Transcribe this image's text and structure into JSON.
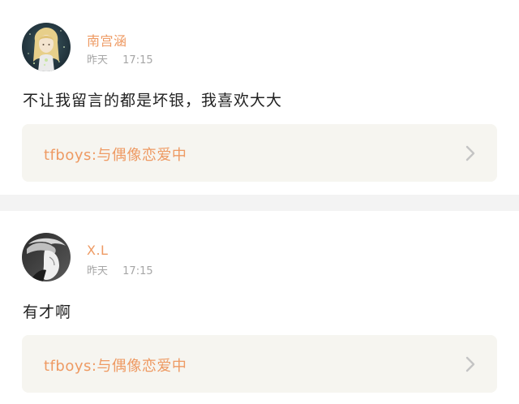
{
  "comments": [
    {
      "username": "南宫涵",
      "date": "昨天",
      "time": "17:15",
      "text": "不让我留言的都是坏银，我喜欢大大",
      "topic": "tfboys:与偶像恋爱中",
      "avatar_icon": "illustrated-girl-avatar"
    },
    {
      "username": "X.L",
      "date": "昨天",
      "time": "17:15",
      "text": "有才啊",
      "topic": "tfboys:与偶像恋爱中",
      "avatar_icon": "monochrome-portrait-avatar"
    }
  ],
  "colors": {
    "accent": "#ee9a63",
    "meta": "#a6a6a6",
    "text": "#222222",
    "card_bg": "#f6f5f0",
    "separator": "#f3f3f3"
  },
  "icons": {
    "chevron": "chevron-right-icon"
  }
}
